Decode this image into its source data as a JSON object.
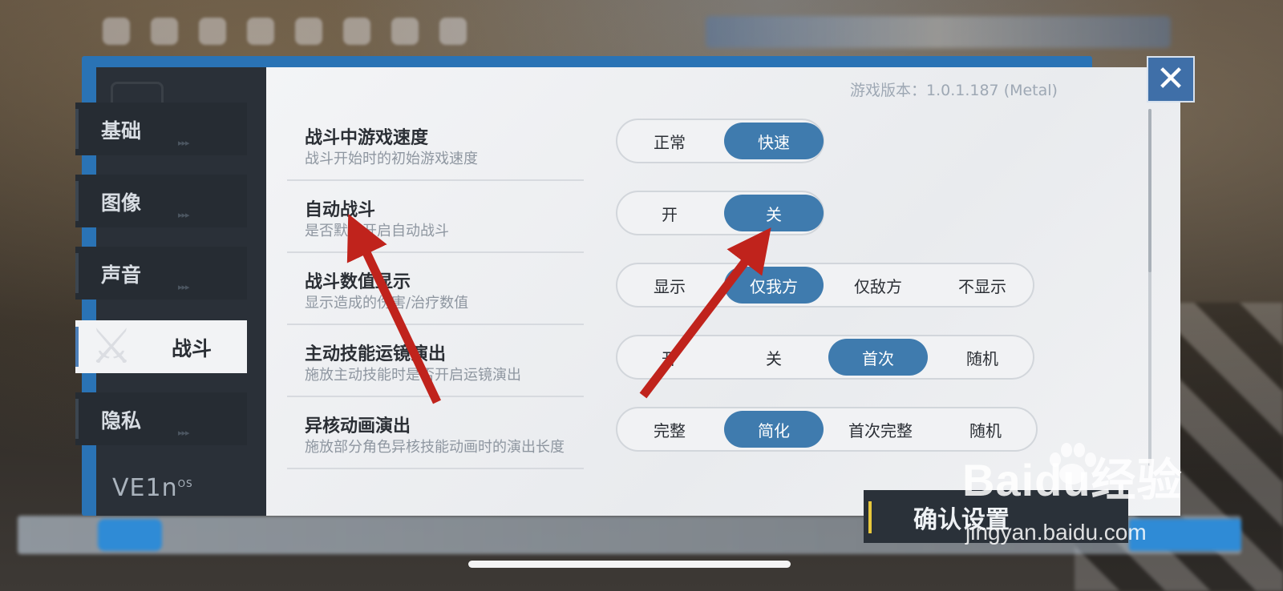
{
  "version_text": "游戏版本：1.0.1.187 (Metal)",
  "tabs": [
    {
      "label": "基础"
    },
    {
      "label": "图像"
    },
    {
      "label": "声音"
    },
    {
      "label": "战斗"
    },
    {
      "label": "隐私"
    }
  ],
  "active_tab": "战斗",
  "settings": [
    {
      "title": "战斗中游戏速度",
      "desc": "战斗开始时的初始游戏速度",
      "options": [
        "正常",
        "快速"
      ],
      "selected": "快速"
    },
    {
      "title": "自动战斗",
      "desc": "是否默认开启自动战斗",
      "options": [
        "开",
        "关"
      ],
      "selected": "关"
    },
    {
      "title": "战斗数值显示",
      "desc": "显示造成的伤害/治疗数值",
      "options": [
        "显示",
        "仅我方",
        "仅敌方",
        "不显示"
      ],
      "selected": "仅我方"
    },
    {
      "title": "主动技能运镜演出",
      "desc": "施放主动技能时是否开启运镜演出",
      "options": [
        "开",
        "关",
        "首次",
        "随机"
      ],
      "selected": "首次"
    },
    {
      "title": "异核动画演出",
      "desc": "施放部分角色异核技能动画时的演出长度",
      "options": [
        "完整",
        "简化",
        "首次完整",
        "随机"
      ],
      "selected": "简化"
    }
  ],
  "confirm_label": "确认设置",
  "logo_text": "VE1n",
  "logo_sup": "OS",
  "watermark": {
    "main": "Baidu经验",
    "sub": "jingyan.baidu.com"
  },
  "close_icon": "close-icon",
  "colors": {
    "selected": "#3f7bae",
    "arrow": "#c0231c",
    "confirm_accent": "#e7c73c"
  }
}
